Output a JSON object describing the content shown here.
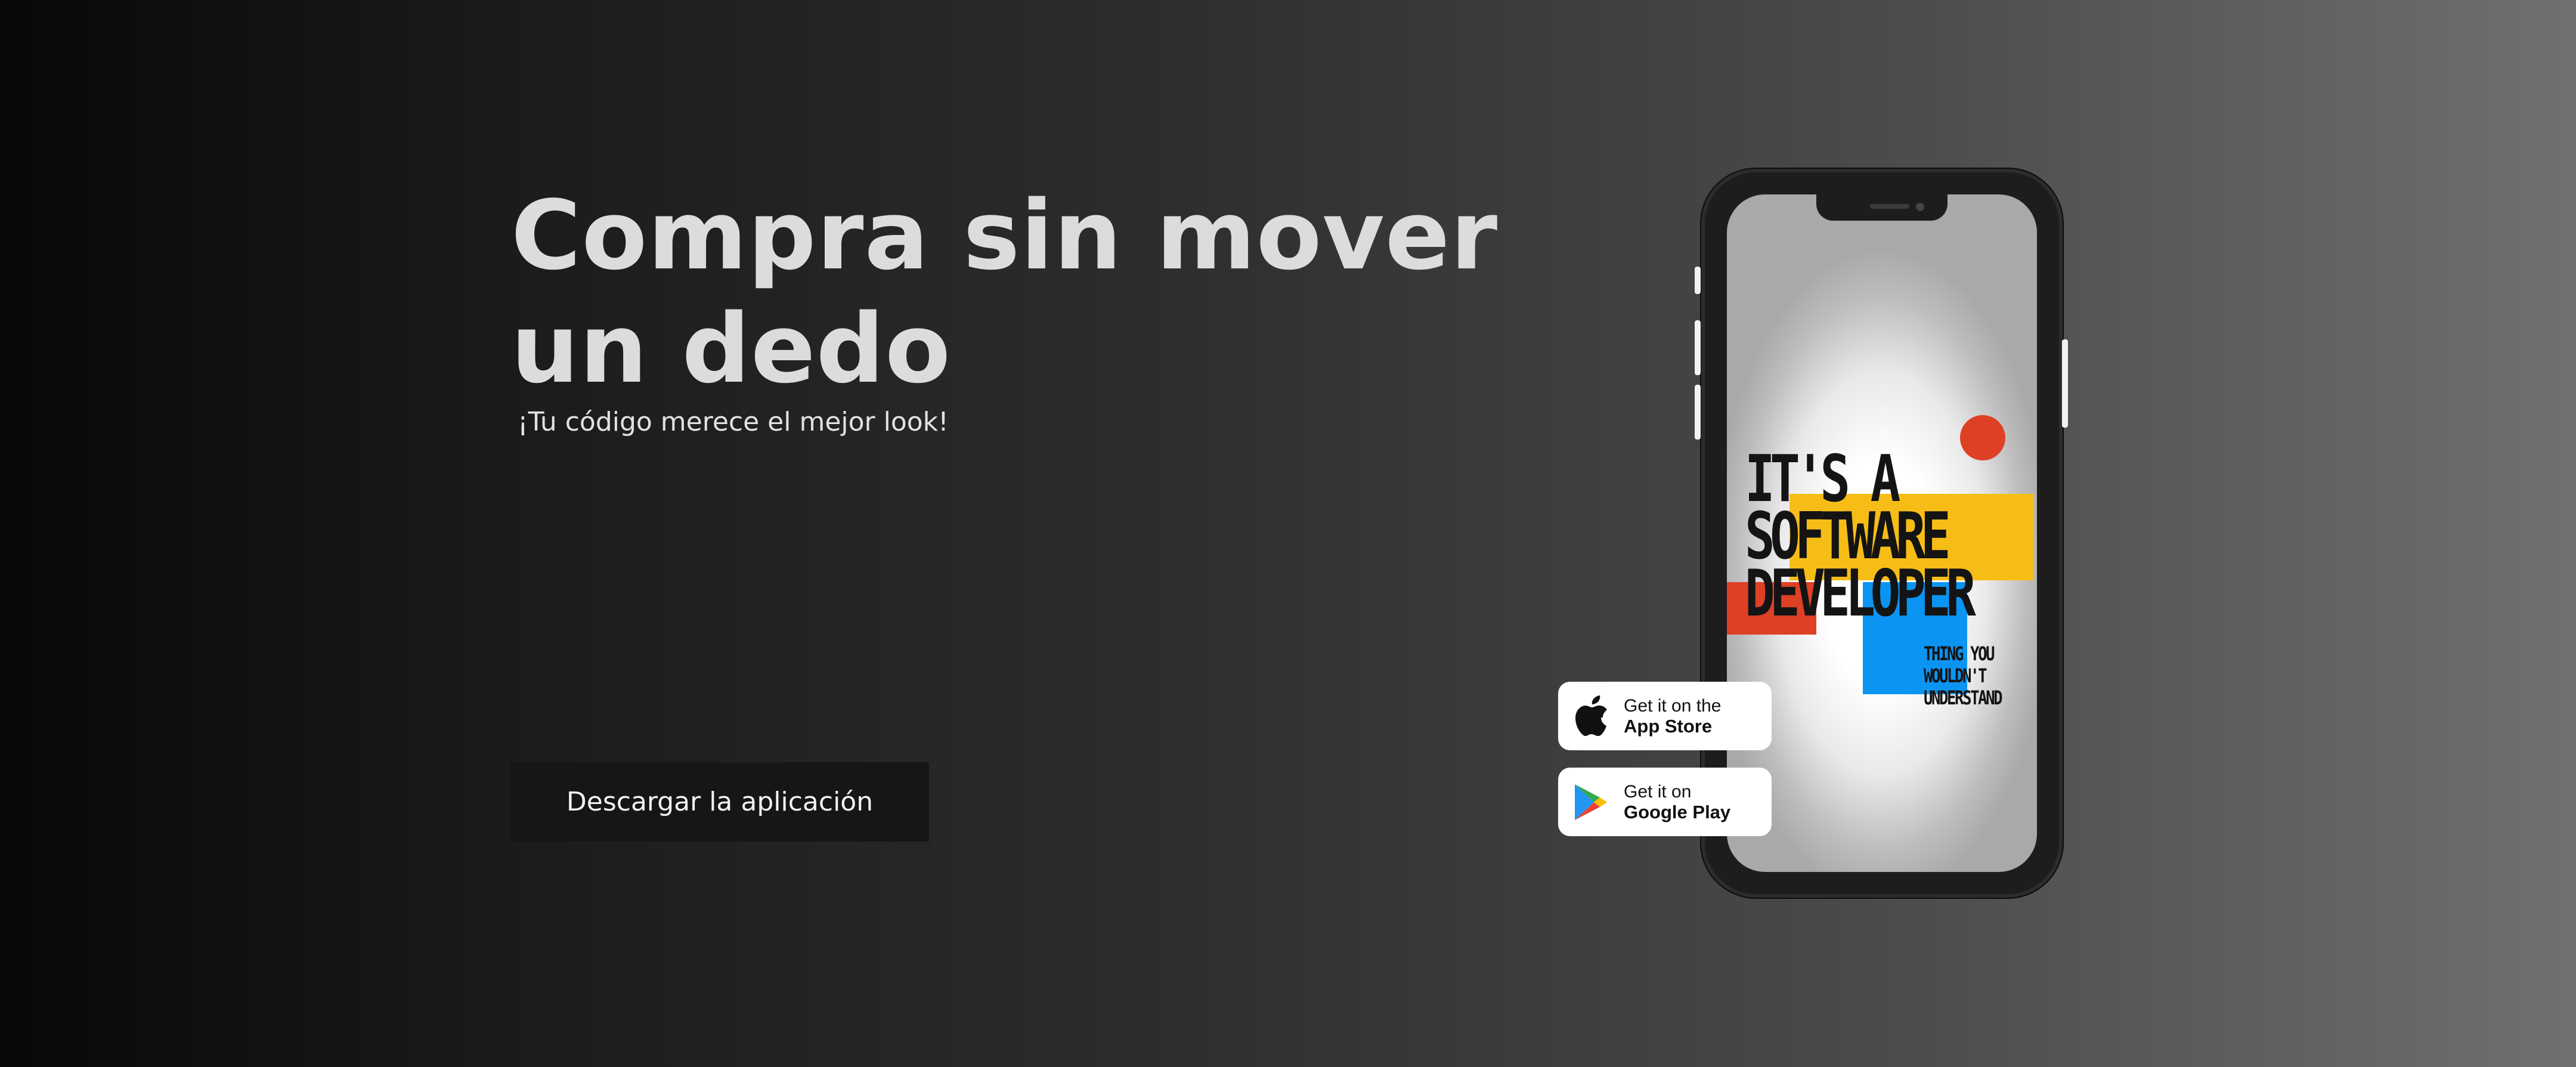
{
  "hero": {
    "title": "Compra sin mover un dedo",
    "subtitle": "¡Tu código merece el mejor look!",
    "cta_label": "Descargar la aplicación"
  },
  "phone_screen": {
    "headline": "IT'S A\nSOFTWARE\nDEVELOPER",
    "tagline": "THING YOU\nWOULDN'T\nUNDERSTAND"
  },
  "badges": {
    "app_store": {
      "line1": "Get it on the",
      "line2": "App Store",
      "icon": "apple-icon"
    },
    "google_play": {
      "line1": "Get it on",
      "line2": "Google Play",
      "icon": "google-play-icon"
    }
  },
  "colors": {
    "accent_yellow": "#f7bd17",
    "accent_red": "#de4026",
    "accent_blue": "#0b94f2"
  }
}
